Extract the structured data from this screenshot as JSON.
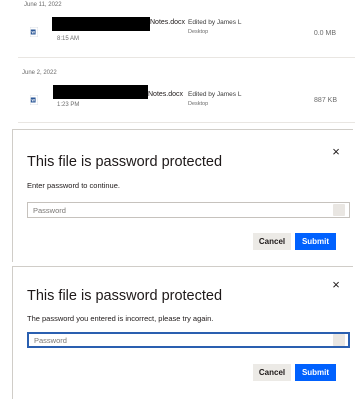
{
  "files": [
    {
      "date": "June 11, 2022",
      "name_suffix": "Notes.docx",
      "time": "8:15 AM",
      "editor": "Edited by James L",
      "device": "Desktop",
      "size": "0.0 MB",
      "icon": "word-doc-icon"
    },
    {
      "date": "June 2, 2022",
      "name_suffix": "Notes.docx",
      "time": "1:23 PM",
      "editor": "Edited by James L",
      "device": "Desktop",
      "size": "887 KB",
      "icon": "word-doc-icon"
    }
  ],
  "dialog1": {
    "title": "This file is password protected",
    "message": "Enter password to continue.",
    "placeholder": "Password",
    "cancel": "Cancel",
    "submit": "Submit",
    "close_icon": "×"
  },
  "dialog2": {
    "title": "This file is password protected",
    "message": "The password you entered is incorrect, please try again.",
    "placeholder": "Password",
    "cancel": "Cancel",
    "submit": "Submit",
    "close_icon": "×"
  },
  "colors": {
    "accent": "#0061fe",
    "focus_border": "#2a5fb0",
    "redaction": "#000000"
  }
}
